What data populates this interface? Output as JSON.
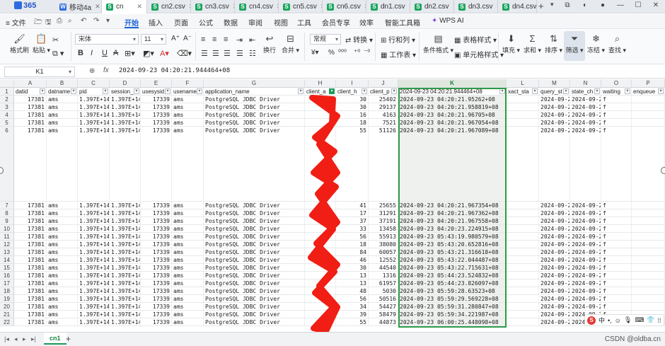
{
  "app": {
    "brand": "365",
    "active_tab_label": "cn",
    "watermark": "CSDN @oldba.cn"
  },
  "tabs": [
    {
      "label": "移动4a",
      "type": "w"
    },
    {
      "label": "cn",
      "type": "s",
      "active": true
    },
    {
      "label": "cn2.csv",
      "type": "s"
    },
    {
      "label": "cn3.csv",
      "type": "s"
    },
    {
      "label": "cn4.csv",
      "type": "s"
    },
    {
      "label": "cn5.csv",
      "type": "s"
    },
    {
      "label": "cn6.csv",
      "type": "s"
    },
    {
      "label": "dn1.csv",
      "type": "s"
    },
    {
      "label": "dn2.csv",
      "type": "s"
    },
    {
      "label": "dn3.csv",
      "type": "s"
    },
    {
      "label": "dn4.csv",
      "type": "s"
    }
  ],
  "menu": {
    "file": "文件",
    "items": [
      "开始",
      "插入",
      "页面",
      "公式",
      "数据",
      "审阅",
      "视图",
      "工具",
      "会员专享",
      "效率",
      "智能工具箱"
    ],
    "wps_ai": "WPS AI"
  },
  "ribbon": {
    "format_painter": "格式刷",
    "paste": "粘贴",
    "font_name": "宋体",
    "font_size": "11",
    "wrap": "换行",
    "merge": "合并",
    "number_format": "常规",
    "convert": "转换",
    "rows_cols": "行和列",
    "worksheet": "工作表",
    "cond_format": "条件格式",
    "table_style": "表格样式",
    "cell_style": "单元格样式",
    "fill": "填充",
    "sum": "求和",
    "sort": "排序",
    "filter": "筛选",
    "freeze": "冻结",
    "find": "查找"
  },
  "formula_bar": {
    "cell_ref": "K1",
    "fx": "fx",
    "content": "2024-09-23 04:20:21.944464+08"
  },
  "columns": [
    "A",
    "B",
    "C",
    "D",
    "E",
    "F",
    "G",
    "H",
    "I",
    "J",
    "K",
    "L",
    "M",
    "N",
    "O",
    "P"
  ],
  "selected_column": "K",
  "headers": [
    "datid",
    "datname",
    "pid",
    "session_",
    "usesysid",
    "usename",
    "application_name",
    "client_a",
    "client_h",
    "client_p",
    "2024-09-23 04:20:21.944464+08",
    "xact_sta",
    "query_st",
    "state_ch",
    "waiting",
    "enqueue"
  ],
  "rows": [
    {
      "n": "2",
      "c": [
        "17381",
        "ams",
        "1.397E+14",
        "1.397E+14",
        "17339",
        "ams",
        "PostgreSQL JDBC Driver",
        "",
        "30",
        "25402",
        "2024-09-23 04:20:21.95262+08",
        "",
        "2024-09-2",
        "2024-09-2",
        "f",
        ""
      ]
    },
    {
      "n": "3",
      "c": [
        "17381",
        "ams",
        "1.397E+14",
        "1.397E+14",
        "17339",
        "ams",
        "PostgreSQL JDBC Driver",
        "",
        "30",
        "29137",
        "2024-09-23 04:20:21.958819+08",
        "",
        "2024-09-2",
        "2024-09-2",
        "f",
        ""
      ]
    },
    {
      "n": "4",
      "c": [
        "17381",
        "ams",
        "1.397E+14",
        "1.397E+14",
        "17339",
        "ams",
        "PostgreSQL JDBC Driver",
        "",
        "16",
        "4163",
        "2024-09-23 04:20:21.96705+08",
        "",
        "2024-09-2",
        "2024-09-2",
        "f",
        ""
      ]
    },
    {
      "n": "5",
      "c": [
        "17381",
        "ams",
        "1.397E+14",
        "1.397E+14",
        "17339",
        "ams",
        "PostgreSQL JDBC Driver",
        "",
        "18",
        "7521",
        "2024-09-23 04:20:21.967054+08",
        "",
        "2024-09-2",
        "2024-09-2",
        "f",
        ""
      ]
    },
    {
      "n": "6",
      "c": [
        "17381",
        "ams",
        "1.397E+14",
        "1.397E+14",
        "17339",
        "ams",
        "PostgreSQL JDBC Driver",
        "",
        "55",
        "51126",
        "2024-09-23 04:20:21.967089+08",
        "",
        "2024-09-2",
        "2024-09-2",
        "f",
        ""
      ]
    },
    {
      "n": "7",
      "c": [
        "17381",
        "ams",
        "1.397E+14",
        "1.397E+14",
        "17339",
        "ams",
        "PostgreSQL JDBC Driver",
        "",
        "41",
        "25655",
        "2024-09-23 04:20:21.967354+08",
        "",
        "2024-09-2",
        "2024-09-2",
        "f",
        ""
      ]
    },
    {
      "n": "8",
      "c": [
        "17381",
        "ams",
        "1.397E+14",
        "1.397E+14",
        "17339",
        "ams",
        "PostgreSQL JDBC Driver",
        "",
        "17",
        "31291",
        "2024-09-23 04:20:21.967362+08",
        "",
        "2024-09-2",
        "2024-09-2",
        "f",
        ""
      ]
    },
    {
      "n": "9",
      "c": [
        "17381",
        "ams",
        "1.397E+14",
        "1.397E+14",
        "17339",
        "ams",
        "PostgreSQL JDBC Driver",
        "",
        "37",
        "37191",
        "2024-09-23 04:20:21.967558+08",
        "",
        "2024-09-2",
        "2024-09-2",
        "f",
        ""
      ]
    },
    {
      "n": "10",
      "c": [
        "17381",
        "ams",
        "1.397E+14",
        "1.397E+14",
        "17339",
        "ams",
        "PostgreSQL JDBC Driver",
        "",
        "33",
        "13458",
        "2024-09-23 04:20:23.224915+08",
        "",
        "2024-09-2",
        "2024-09-2",
        "f",
        ""
      ]
    },
    {
      "n": "11",
      "c": [
        "17381",
        "ams",
        "1.397E+14",
        "1.397E+14",
        "17339",
        "ams",
        "PostgreSQL JDBC Driver",
        "",
        "56",
        "55913",
        "2024-09-23 05:43:19.980579+08",
        "",
        "2024-09-2",
        "2024-09-2",
        "f",
        ""
      ]
    },
    {
      "n": "12",
      "c": [
        "17381",
        "ams",
        "1.397E+14",
        "1.397E+14",
        "17339",
        "ams",
        "PostgreSQL JDBC Driver",
        "",
        "18",
        "38080",
        "2024-09-23 05:43:20.652816+08",
        "",
        "2024-09-2",
        "2024-09-2",
        "f",
        ""
      ]
    },
    {
      "n": "13",
      "c": [
        "17381",
        "ams",
        "1.397E+14",
        "1.397E+14",
        "17339",
        "ams",
        "PostgreSQL JDBC Driver",
        "",
        "84",
        "60057",
        "2024-09-23 05:43:21.316618+08",
        "",
        "2024-09-2",
        "2024-09-2",
        "f",
        ""
      ]
    },
    {
      "n": "14",
      "c": [
        "17381",
        "ams",
        "1.397E+14",
        "1.397E+14",
        "17339",
        "ams",
        "PostgreSQL JDBC Driver",
        "",
        "46",
        "12552",
        "2024-09-23 05:43:22.044487+08",
        "",
        "2024-09-2",
        "2024-09-2",
        "f",
        ""
      ]
    },
    {
      "n": "15",
      "c": [
        "17381",
        "ams",
        "1.397E+14",
        "1.397E+14",
        "17339",
        "ams",
        "PostgreSQL JDBC Driver",
        "",
        "30",
        "44540",
        "2024-09-23 05:43:22.715631+08",
        "",
        "2024-09-2",
        "2024-09-2",
        "f",
        ""
      ]
    },
    {
      "n": "16",
      "c": [
        "17381",
        "ams",
        "1.397E+14",
        "1.397E+14",
        "17339",
        "ams",
        "PostgreSQL JDBC Driver",
        "",
        "13",
        "1316",
        "2024-09-23 05:44:23.524832+08",
        "",
        "2024-09-2",
        "2024-09-2",
        "f",
        ""
      ]
    },
    {
      "n": "17",
      "c": [
        "17381",
        "ams",
        "1.397E+14",
        "1.397E+14",
        "17339",
        "ams",
        "PostgreSQL JDBC Driver",
        "",
        "13",
        "61957",
        "2024-09-23 05:44:23.826097+08",
        "",
        "2024-09-2",
        "2024-09-2",
        "f",
        ""
      ]
    },
    {
      "n": "18",
      "c": [
        "17381",
        "ams",
        "1.397E+14",
        "1.397E+14",
        "17339",
        "ams",
        "PostgreSQL JDBC Driver",
        "",
        "48",
        "5030",
        "2024-09-23 05:59:28.63523+08",
        "",
        "2024-09-2",
        "2024-09-2",
        "f",
        ""
      ]
    },
    {
      "n": "19",
      "c": [
        "17381",
        "ams",
        "1.397E+14",
        "1.397E+14",
        "17339",
        "ams",
        "PostgreSQL JDBC Driver",
        "",
        "56",
        "50516",
        "2024-09-23 05:59:29.569228+08",
        "",
        "2024-09-2",
        "2024-09-2",
        "f",
        ""
      ]
    },
    {
      "n": "20",
      "c": [
        "17381",
        "ams",
        "1.397E+14",
        "1.397E+14",
        "17339",
        "ams",
        "PostgreSQL JDBC Driver",
        "",
        "34",
        "54427",
        "2024-09-23 05:59:31.280847+08",
        "",
        "2024-09-2",
        "2024-09-2",
        "f",
        ""
      ]
    },
    {
      "n": "21",
      "c": [
        "17381",
        "ams",
        "1.397E+14",
        "1.397E+14",
        "17339",
        "ams",
        "PostgreSQL JDBC Driver",
        "",
        "39",
        "58479",
        "2024-09-23 05:59:34.221987+08",
        "",
        "2024-09-2",
        "2024-09-2",
        "f",
        ""
      ]
    },
    {
      "n": "22",
      "c": [
        "17381",
        "ams",
        "1.397E+14",
        "1.397E+14",
        "17339",
        "ams",
        "PostgreSQL JDBC Driver",
        "",
        "55",
        "44873",
        "2024-09-23 06:00:25.448098+08",
        "",
        "2024-09-2",
        "2024-09-2",
        "f",
        ""
      ]
    }
  ],
  "sheet": {
    "name": "cn1"
  },
  "ime": {
    "lang": "中"
  }
}
